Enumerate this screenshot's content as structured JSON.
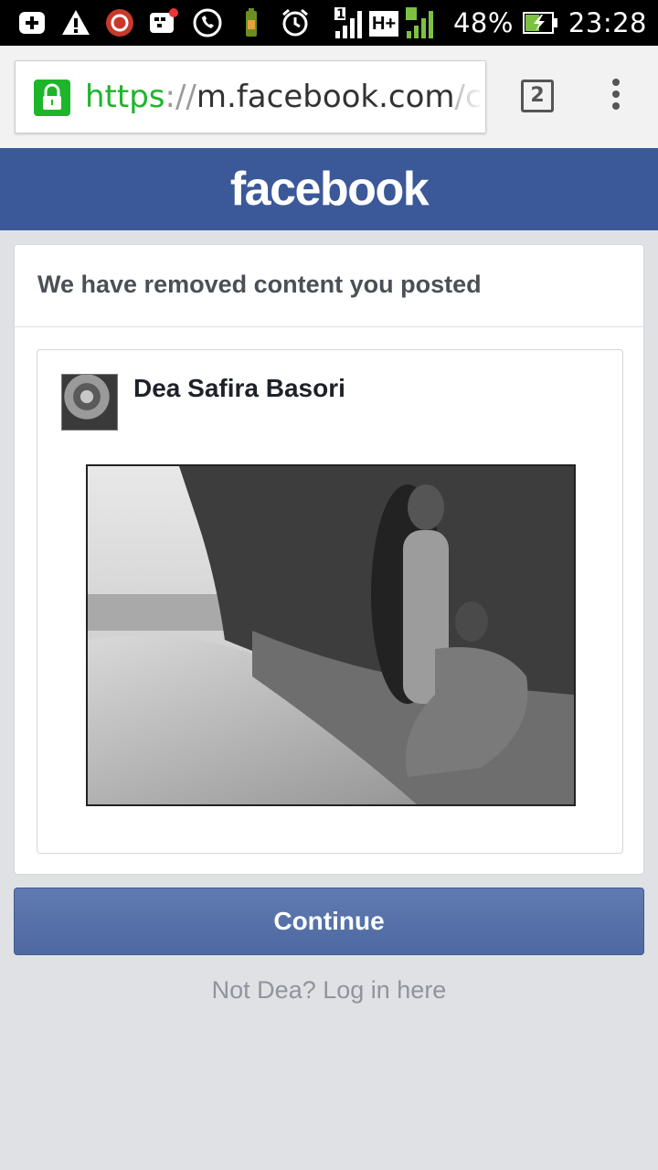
{
  "status_bar": {
    "battery": "48%",
    "time": "23:28",
    "network_type": "H+",
    "sim1": "1",
    "sim2": "2",
    "notification_icons": [
      "add-box-icon",
      "warning-icon",
      "sync-icon",
      "bbm-icon",
      "whatsapp-icon",
      "battery-saver-icon",
      "alarm-icon"
    ]
  },
  "browser": {
    "url_scheme": "https",
    "url_sep": "://",
    "url_host": "m.facebook.com",
    "url_path": "/che",
    "tab_count": "2"
  },
  "header": {
    "logo": "facebook",
    "color": "#3b5998"
  },
  "notice": {
    "title": "We have removed content you posted",
    "author": "Dea Safira Basori"
  },
  "actions": {
    "continue_label": "Continue",
    "not_you_link": "Not Dea? Log in here"
  }
}
